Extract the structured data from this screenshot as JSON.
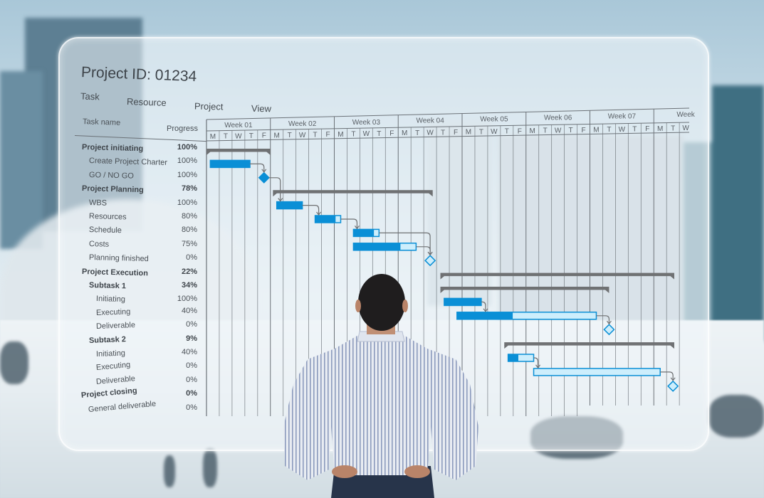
{
  "scene": {
    "description": "Man viewed from behind, hands on hips, looking at a holographic Gantt chart panel overlaid on a blurred city plaza with tall buildings",
    "person": {
      "shirt": "blue-white striped dress shirt",
      "pants": "dark jeans",
      "hair": "dark curly"
    }
  },
  "header": {
    "title": "Project ID: 01234",
    "menu": [
      "Task",
      "Resource",
      "Project",
      "View"
    ]
  },
  "columns": {
    "task_name": "Task name",
    "progress": "Progress"
  },
  "timeline": {
    "weeks": [
      "Week 01",
      "Week 02",
      "Week 03",
      "Week 04",
      "Week 05",
      "Week 06",
      "Week 07",
      "Week"
    ],
    "days": [
      "M",
      "T",
      "W",
      "T",
      "F"
    ],
    "last_week_days": [
      "M",
      "T",
      "W"
    ]
  },
  "colors": {
    "bar_done": "#0a8fd6",
    "bar_remaining": "#cdeefc",
    "bar_outline": "#0a8fd6",
    "summary": "#6f7173",
    "grid": "#6c7278",
    "connector": "#6f7173"
  },
  "tasks": [
    {
      "name": "Project initiating",
      "progress": "100%",
      "level": 0,
      "type": "summary",
      "start": 0,
      "end": 5
    },
    {
      "name": "Create Project Charter",
      "progress": "100%",
      "level": 1,
      "type": "task",
      "start": 0.3,
      "end": 3.4,
      "fraction": 1.0
    },
    {
      "name": "GO / NO GO",
      "progress": "100%",
      "level": 1,
      "type": "milestone",
      "start": 4.5,
      "done": true
    },
    {
      "name": "Project Planning",
      "progress": "78%",
      "level": 0,
      "type": "summary",
      "start": 5.2,
      "end": 17.7
    },
    {
      "name": "WBS",
      "progress": "100%",
      "level": 1,
      "type": "task",
      "start": 5.5,
      "end": 7.5,
      "fraction": 1.0
    },
    {
      "name": "Resources",
      "progress": "80%",
      "level": 1,
      "type": "task",
      "start": 8.5,
      "end": 10.5,
      "fraction": 0.8
    },
    {
      "name": "Schedule",
      "progress": "80%",
      "level": 1,
      "type": "task",
      "start": 11.5,
      "end": 13.5,
      "fraction": 0.8
    },
    {
      "name": "Costs",
      "progress": "75%",
      "level": 1,
      "type": "task",
      "start": 11.5,
      "end": 16.4,
      "fraction": 0.75
    },
    {
      "name": "Planning finished",
      "progress": "0%",
      "level": 1,
      "type": "milestone",
      "start": 17.5,
      "done": false
    },
    {
      "name": "Project Execution",
      "progress": "22%",
      "level": 0,
      "type": "summary",
      "start": 18.3,
      "end": 36.6
    },
    {
      "name": "Subtask 1",
      "progress": "34%",
      "level": 1,
      "type": "summary",
      "start": 18.3,
      "end": 31.5
    },
    {
      "name": "Initiating",
      "progress": "100%",
      "level": 2,
      "type": "task",
      "start": 18.6,
      "end": 21.5,
      "fraction": 1.0
    },
    {
      "name": "Executing",
      "progress": "40%",
      "level": 2,
      "type": "task",
      "start": 19.6,
      "end": 30.5,
      "fraction": 0.4
    },
    {
      "name": "Deliverable",
      "progress": "0%",
      "level": 2,
      "type": "milestone",
      "start": 31.5,
      "done": false
    },
    {
      "name": "Subtask 2",
      "progress": "9%",
      "level": 1,
      "type": "summary",
      "start": 23.3,
      "end": 36.6
    },
    {
      "name": "Initiating",
      "progress": "40%",
      "level": 2,
      "type": "task",
      "start": 23.6,
      "end": 25.6,
      "fraction": 0.4
    },
    {
      "name": "Executing",
      "progress": "0%",
      "level": 2,
      "type": "task",
      "start": 25.6,
      "end": 35.5,
      "fraction": 0.0
    },
    {
      "name": "Deliverable",
      "progress": "0%",
      "level": 2,
      "type": "milestone",
      "start": 36.5,
      "done": false
    },
    {
      "name": "Project closing",
      "progress": "0%",
      "level": 0,
      "type": "summary",
      "start": null,
      "end": null
    },
    {
      "name": "General deliverable",
      "progress": "0%",
      "level": 1,
      "type": "milestone",
      "start": null,
      "done": false
    }
  ],
  "dependencies": [
    [
      1,
      2
    ],
    [
      2,
      4
    ],
    [
      4,
      5
    ],
    [
      5,
      6
    ],
    [
      6,
      8
    ],
    [
      7,
      8
    ],
    [
      11,
      12
    ],
    [
      12,
      13
    ],
    [
      15,
      16
    ],
    [
      16,
      17
    ]
  ]
}
